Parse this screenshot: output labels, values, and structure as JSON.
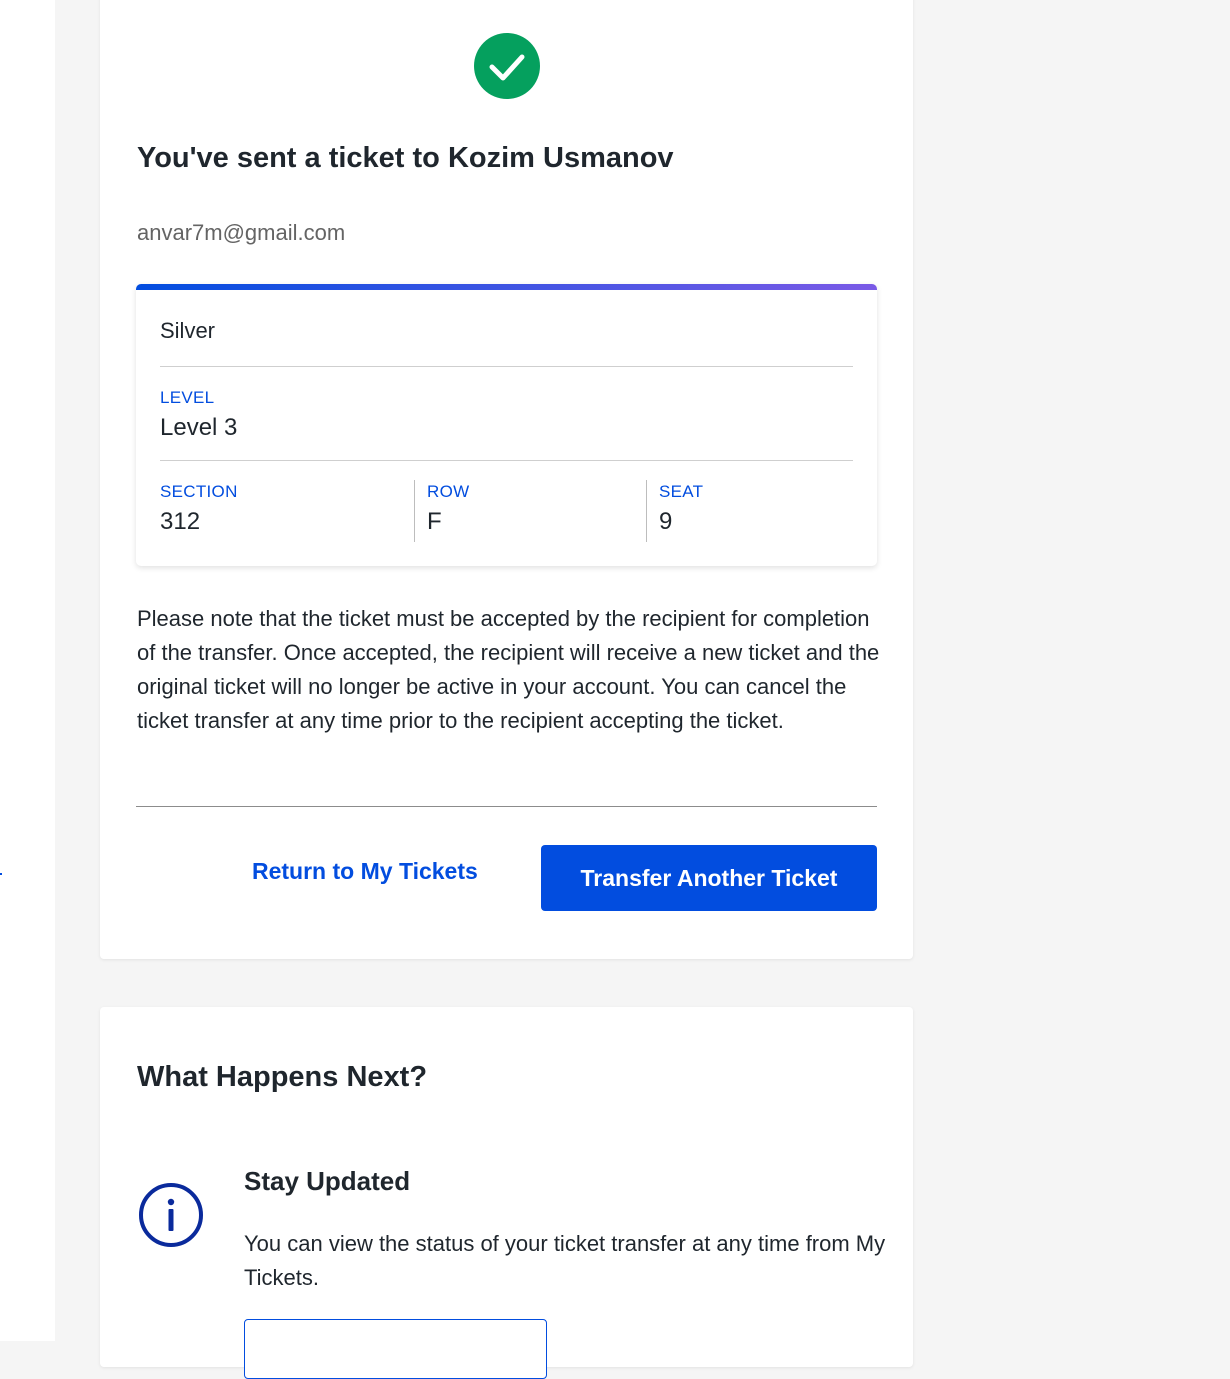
{
  "confirmation": {
    "title": "You've sent a ticket to Kozim Usmanov",
    "email": "anvar7m@gmail.com",
    "success_icon": "check-circle-icon",
    "success_color": "#05a05e"
  },
  "ticket": {
    "name": "Silver",
    "level_label": "LEVEL",
    "level_value": "Level 3",
    "section_label": "SECTION",
    "section_value": "312",
    "row_label": "ROW",
    "row_value": "F",
    "seat_label": "SEAT",
    "seat_value": "9",
    "accent_gradient": [
      "#024ddf",
      "#7a5ae6"
    ]
  },
  "note": "Please note that the ticket must be accepted by the recipient for completion of the transfer. Once accepted, the recipient will receive a new ticket and the original ticket will no longer be active in your account. You can cancel the ticket transfer at any time prior to the recipient accepting the ticket.",
  "actions": {
    "return_label": "Return to My Tickets",
    "transfer_label": "Transfer Another Ticket",
    "primary_color": "#024ddf"
  },
  "next_steps": {
    "title": "What Happens Next?",
    "item_icon": "info-circle-icon",
    "item_title": "Stay Updated",
    "item_text": "You can view the status of your ticket transfer at any time from My Tickets."
  }
}
